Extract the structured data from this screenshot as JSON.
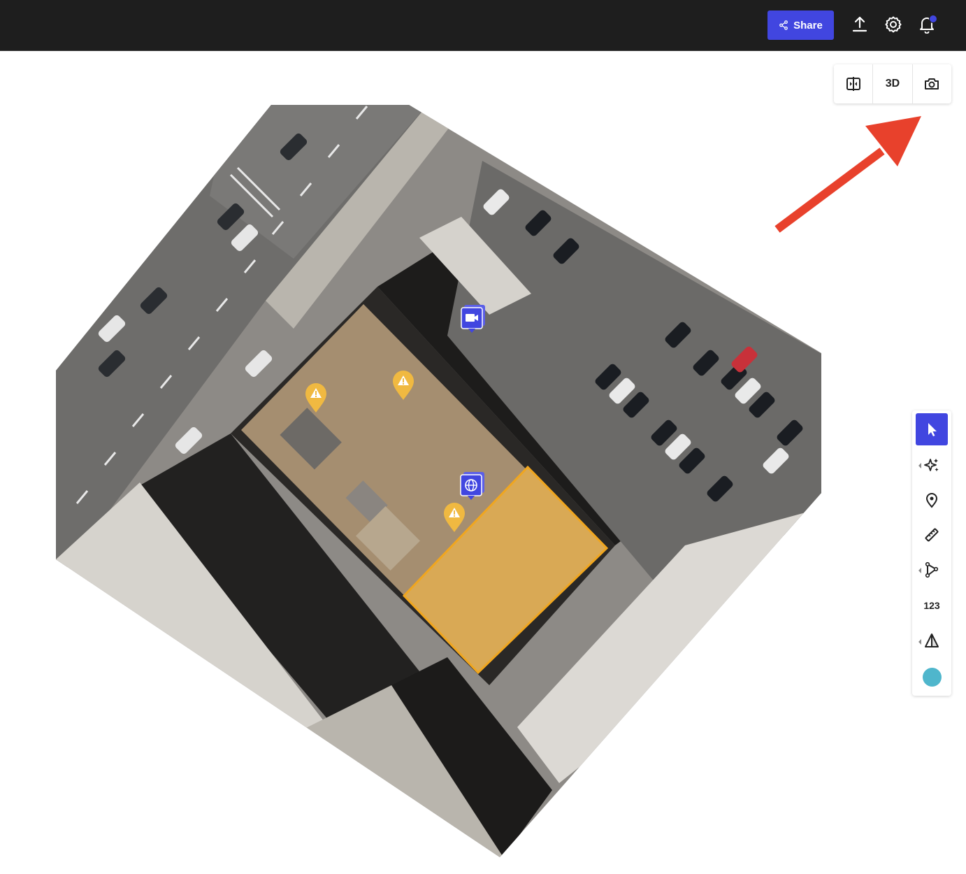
{
  "header": {
    "share_label": "Share",
    "icons": [
      "share-icon",
      "upload-icon",
      "gear-icon",
      "bell-icon"
    ],
    "notification_dot_color": "#4146e0",
    "accent_color": "#4146e0"
  },
  "view_controls": {
    "compare_icon": "compare-icon",
    "mode_label": "3D",
    "screenshot_icon": "camera-icon"
  },
  "toolbar": {
    "tools": [
      {
        "name": "select",
        "icon": "cursor-icon",
        "active": true
      },
      {
        "name": "ai-detect",
        "icon": "sparkle-icon"
      },
      {
        "name": "pin",
        "icon": "location-pin-icon"
      },
      {
        "name": "measure-distance",
        "icon": "ruler-icon"
      },
      {
        "name": "polyline",
        "icon": "polyline-icon"
      },
      {
        "name": "count",
        "label": "123"
      },
      {
        "name": "volume",
        "icon": "pyramid-icon"
      },
      {
        "name": "color",
        "icon": "color-swatch",
        "color": "#4fb6cc"
      }
    ]
  },
  "map": {
    "markers": [
      "video-marker",
      "warning-marker",
      "warning-marker",
      "globe-marker",
      "warning-marker"
    ],
    "highlight_color": "#f0a61f",
    "warning_color": "#f0b941",
    "annotation_arrow_color": "#e8412c"
  }
}
